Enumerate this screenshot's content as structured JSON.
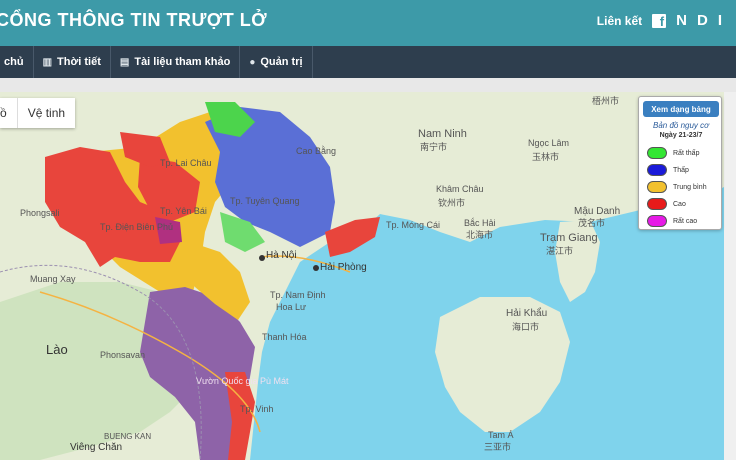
{
  "header": {
    "title": "CỔNG THÔNG TIN TRƯỢT LỞ",
    "links_label": "Liên kết",
    "social": [
      "N",
      "D",
      "I"
    ]
  },
  "nav": {
    "items": [
      {
        "label": "chủ",
        "icon": "home-icon"
      },
      {
        "label": "Thời tiết",
        "icon": "bar-chart-icon"
      },
      {
        "label": "Tài liệu tham khảo",
        "icon": "book-icon"
      },
      {
        "label": "Quản trị",
        "icon": "chat-icon"
      }
    ]
  },
  "map_type": {
    "map": "ồ",
    "satellite": "Vệ tinh"
  },
  "legend": {
    "button": "Xem dạng bảng",
    "title": "Bản đồ nguy cơ",
    "date": "Ngày 21-23/7",
    "levels": [
      {
        "label": "Rất thấp",
        "color": "#33e633"
      },
      {
        "label": "Thấp",
        "color": "#1a1ad9"
      },
      {
        "label": "Trung bình",
        "color": "#f2c12e"
      },
      {
        "label": "Cao",
        "color": "#e81a1a"
      },
      {
        "label": "Rất cao",
        "color": "#e61ae6"
      }
    ]
  },
  "places": {
    "nanning": "Nam Ninh",
    "nanning_cn": "南宁市",
    "yulin": "Ngọc Lâm",
    "yulin_cn": "玉林市",
    "qinzhou": "Khâm Châu",
    "qinzhou_cn": "钦州市",
    "beihai": "Bắc Hải",
    "beihai_cn": "北海市",
    "maoming": "Mậu Danh",
    "maoming_cn": "茂名市",
    "zhanjiang": "Trạm Giang",
    "zhanjiang_cn": "湛江市",
    "haikou": "Hải Khẩu",
    "haikou_cn": "海口市",
    "sanya": "Tam Á",
    "sanya_cn": "三亚市",
    "hanoi": "Hà Nội",
    "haiphong": "Hải Phòng",
    "laos": "Lào",
    "vinh": "Tp. Vinh",
    "thanhhoa": "Thanh Hóa",
    "namdinh": "Tp. Nam Định",
    "caobang": "Cao Bằng",
    "tuyenquang": "Tp. Tuyên Quang",
    "yenbai": "Tp. Yên Bái",
    "laichau": "Tp. Lai Châu",
    "dienbien": "Tp. Điện Biên Phủ",
    "muongla": "Muang Xay",
    "phongsaly": "Phongsali",
    "phonsavan": "Phonsavan",
    "vientiane": "Viêng Chăn",
    "bueng": "BUENG KAN",
    "vuquang": "Vườn Quốc gia Pù Mát",
    "hoaLu": "Hoa Lư",
    "montcai": "Tp. Móng Cái",
    "wuzhou": "梧州市",
    "yulinjia": "Ngọc Lâm"
  },
  "colors": {
    "header": "#3d9aa8",
    "nav": "#2e3e4e",
    "sea": "#7fd3ec",
    "land": "#e6ecd6"
  }
}
